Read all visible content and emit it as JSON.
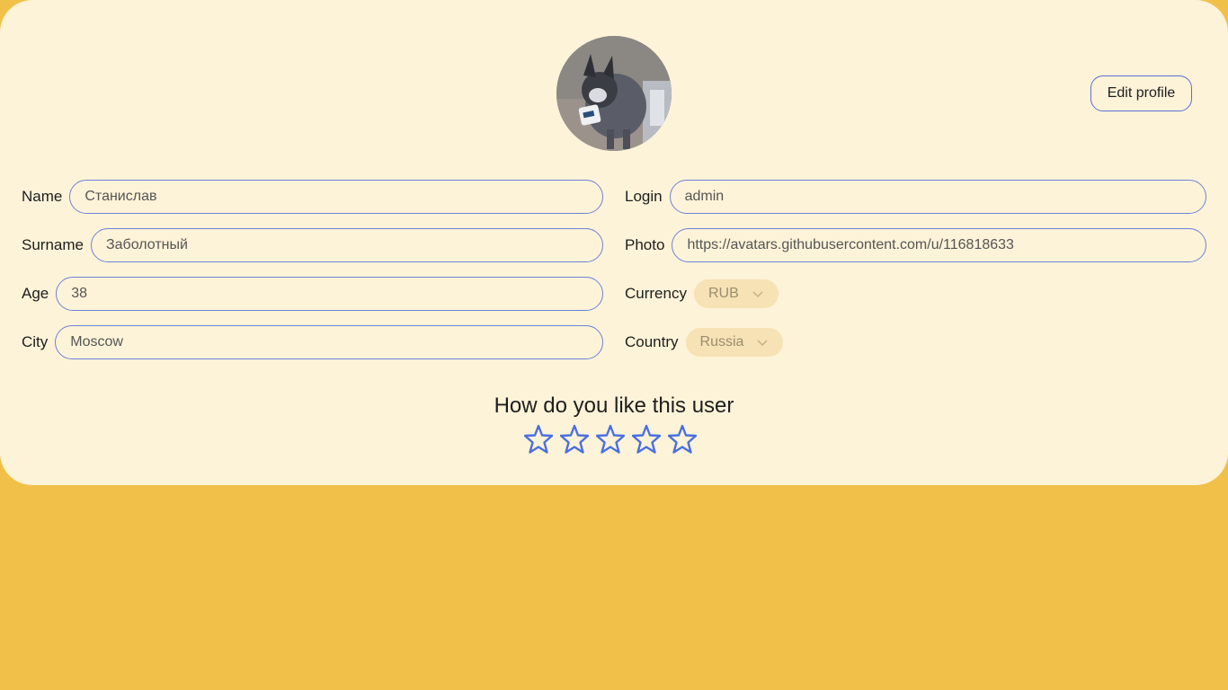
{
  "profile": {
    "edit_label": "Edit profile",
    "avatar_alt": "dog",
    "fields_left": [
      {
        "key": "name",
        "label": "Name",
        "value": "Станислав"
      },
      {
        "key": "surname",
        "label": "Surname",
        "value": "Заболотный"
      },
      {
        "key": "age",
        "label": "Age",
        "value": "38"
      },
      {
        "key": "city",
        "label": "City",
        "value": "Moscow"
      }
    ],
    "fields_right": [
      {
        "key": "login",
        "label": "Login",
        "value": "admin"
      },
      {
        "key": "photo",
        "label": "Photo",
        "value": "https://avatars.githubusercontent.com/u/116818633"
      }
    ],
    "currency": {
      "label": "Currency",
      "value": "RUB"
    },
    "country": {
      "label": "Country",
      "value": "Russia"
    }
  },
  "rating": {
    "title": "How do you like this user",
    "max_stars": 5,
    "selected": 0,
    "star_color": "#4b6fe0"
  },
  "colors": {
    "page_bg": "#f0c049",
    "card_bg": "#fdf3d8",
    "accent": "#5b6fd6"
  }
}
